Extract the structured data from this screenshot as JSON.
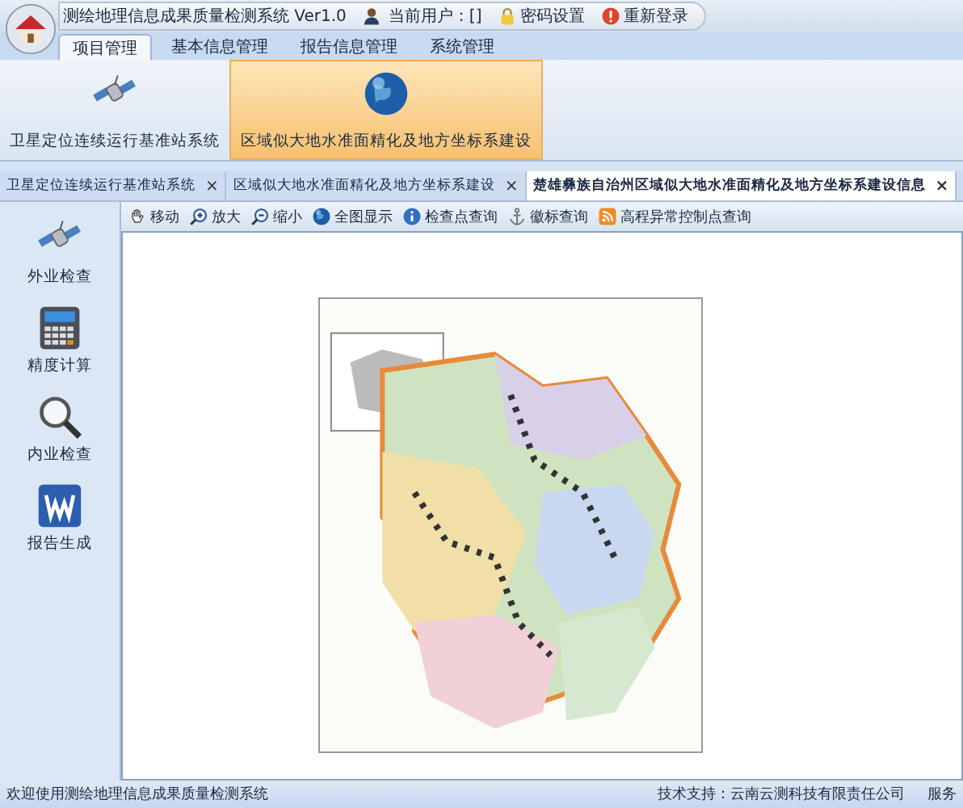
{
  "window": {
    "title": "测绘地理信息成果质量检测系统 Ver1.0",
    "user_label": "当前用户：[]",
    "password_button": "密码设置",
    "relogin_button": "重新登录"
  },
  "ribbon_tabs": [
    {
      "label": "项目管理",
      "selected": true
    },
    {
      "label": "基本信息管理",
      "selected": false
    },
    {
      "label": "报告信息管理",
      "selected": false
    },
    {
      "label": "系统管理",
      "selected": false
    }
  ],
  "ribbon_buttons": [
    {
      "label": "卫星定位连续运行基准站系统",
      "kind": "satellite",
      "selected": false
    },
    {
      "label": "区域似大地水准面精化及地方坐标系建设",
      "kind": "globe",
      "selected": true
    }
  ],
  "doc_tabs": [
    {
      "label": "卫星定位连续运行基准站系统",
      "close": "×",
      "selected": false
    },
    {
      "label": "区域似大地水准面精化及地方坐标系建设",
      "close": "×",
      "selected": false
    },
    {
      "label": "楚雄彝族自治州区域似大地水准面精化及地方坐标系建设信息",
      "close": "×",
      "selected": true
    }
  ],
  "sidebar": {
    "items": [
      {
        "label": "外业检查",
        "kind": "satellite"
      },
      {
        "label": "精度计算",
        "kind": "calculator"
      },
      {
        "label": "内业检查",
        "kind": "magnifier"
      },
      {
        "label": "报告生成",
        "kind": "word"
      }
    ]
  },
  "toolbar": [
    {
      "label": "移动",
      "kind": "hand"
    },
    {
      "label": "放大",
      "kind": "zoomin"
    },
    {
      "label": "缩小",
      "kind": "zoomout"
    },
    {
      "label": "全图显示",
      "kind": "globe"
    },
    {
      "label": "检查点查询",
      "kind": "info"
    },
    {
      "label": "徽标查询",
      "kind": "anchor"
    },
    {
      "label": "高程异常控制点查询",
      "kind": "rss"
    }
  ],
  "status_bar": {
    "message": "欢迎使用测绘地理信息成果质量检测系统",
    "support": "技术支持：云南云测科技有限责任公司",
    "service": "服务"
  }
}
